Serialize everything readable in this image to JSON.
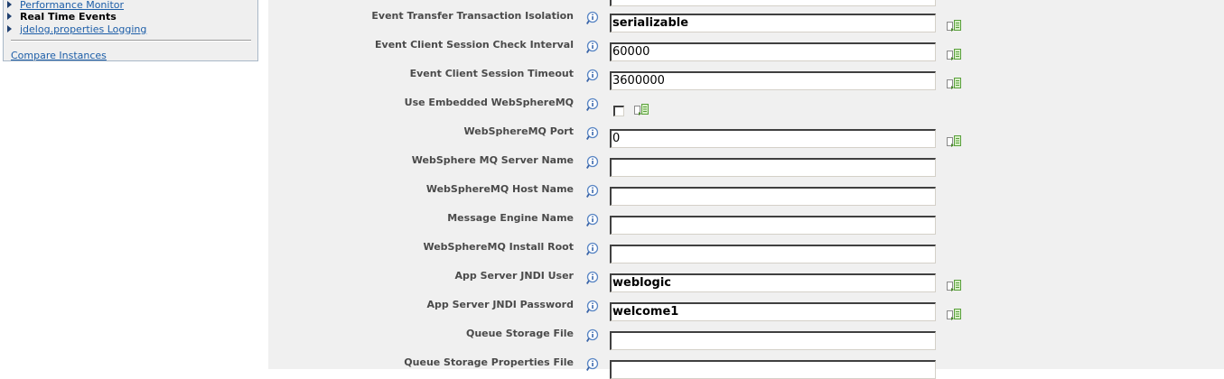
{
  "nav": {
    "items": [
      {
        "label": "Performance Monitor",
        "link": true
      },
      {
        "label": "Real Time Events",
        "link": false
      },
      {
        "label": "jdelog.properties Logging",
        "link": true
      }
    ],
    "compare_link": "Compare Instances"
  },
  "form": {
    "fields": [
      {
        "label": "Event Transfer Transaction Isolation",
        "type": "text",
        "value": "serializable",
        "bold": true,
        "copy": true
      },
      {
        "label": "Event Client Session Check Interval",
        "type": "text",
        "value": "60000",
        "bold": false,
        "copy": true
      },
      {
        "label": "Event Client Session Timeout",
        "type": "text",
        "value": "3600000",
        "bold": false,
        "copy": true
      },
      {
        "label": "Use Embedded WebSphereMQ",
        "type": "checkbox",
        "checked": false,
        "copy": true
      },
      {
        "label": "WebSphereMQ Port",
        "type": "text",
        "value": "0",
        "bold": false,
        "copy": true
      },
      {
        "label": "WebSphere MQ Server Name",
        "type": "text",
        "value": "",
        "bold": false,
        "copy": false
      },
      {
        "label": "WebSphereMQ Host Name",
        "type": "text",
        "value": "",
        "bold": false,
        "copy": false
      },
      {
        "label": "Message Engine Name",
        "type": "text",
        "value": "",
        "bold": false,
        "copy": false
      },
      {
        "label": "WebSphereMQ Install Root",
        "type": "text",
        "value": "",
        "bold": false,
        "copy": false
      },
      {
        "label": "App Server JNDI User",
        "type": "text",
        "value": "weblogic",
        "bold": true,
        "copy": true
      },
      {
        "label": "App Server JNDI Password",
        "type": "text",
        "value": "welcome1",
        "bold": true,
        "copy": true
      },
      {
        "label": "Queue Storage File",
        "type": "text",
        "value": "",
        "bold": false,
        "copy": false
      },
      {
        "label": "Queue Storage Properties File",
        "type": "text",
        "value": "",
        "bold": false,
        "copy": false
      }
    ]
  },
  "icons": {
    "info": "info-magnifier-icon",
    "copy": "copy-value-icon"
  },
  "colors": {
    "link": "#1d5ea8",
    "form_bg": "#f0f0f0",
    "label": "#4a4a4a"
  }
}
